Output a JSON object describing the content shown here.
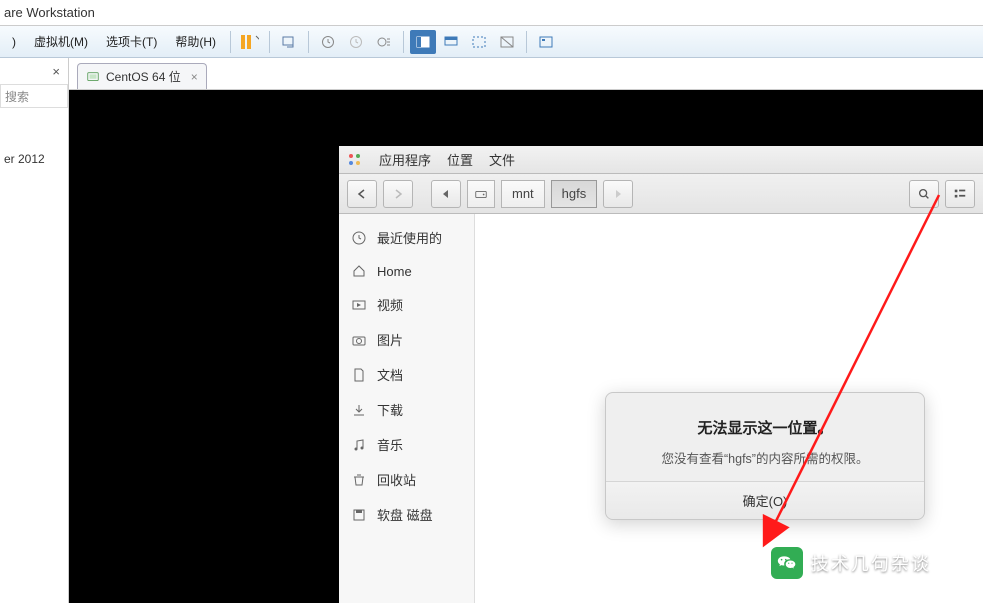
{
  "window": {
    "title_fragment": "are Workstation"
  },
  "menu": {
    "view": ")",
    "vm": "虚拟机(M)",
    "tabs": "选项卡(T)",
    "help": "帮助(H)"
  },
  "left_panel": {
    "close": "×",
    "search_placeholder": "搜索",
    "item1": "er 2012"
  },
  "tab": {
    "label": "CentOS 64 位",
    "close": "×"
  },
  "gnome_top": {
    "apps": "应用程序",
    "places": "位置",
    "files": "文件"
  },
  "breadcrumb": {
    "seg1": "mnt",
    "seg2": "hgfs"
  },
  "sidebar": {
    "recent": "最近使用的",
    "home": "Home",
    "videos": "视频",
    "pictures": "图片",
    "documents": "文档",
    "downloads": "下载",
    "music": "音乐",
    "trash": "回收站",
    "devices": "软盘 磁盘"
  },
  "dialog": {
    "title": "无法显示这一位置。",
    "message": "您没有查看“hgfs”的内容所需的权限。",
    "ok": "确定(O)"
  },
  "watermark": {
    "text": "技术几句杂谈"
  }
}
